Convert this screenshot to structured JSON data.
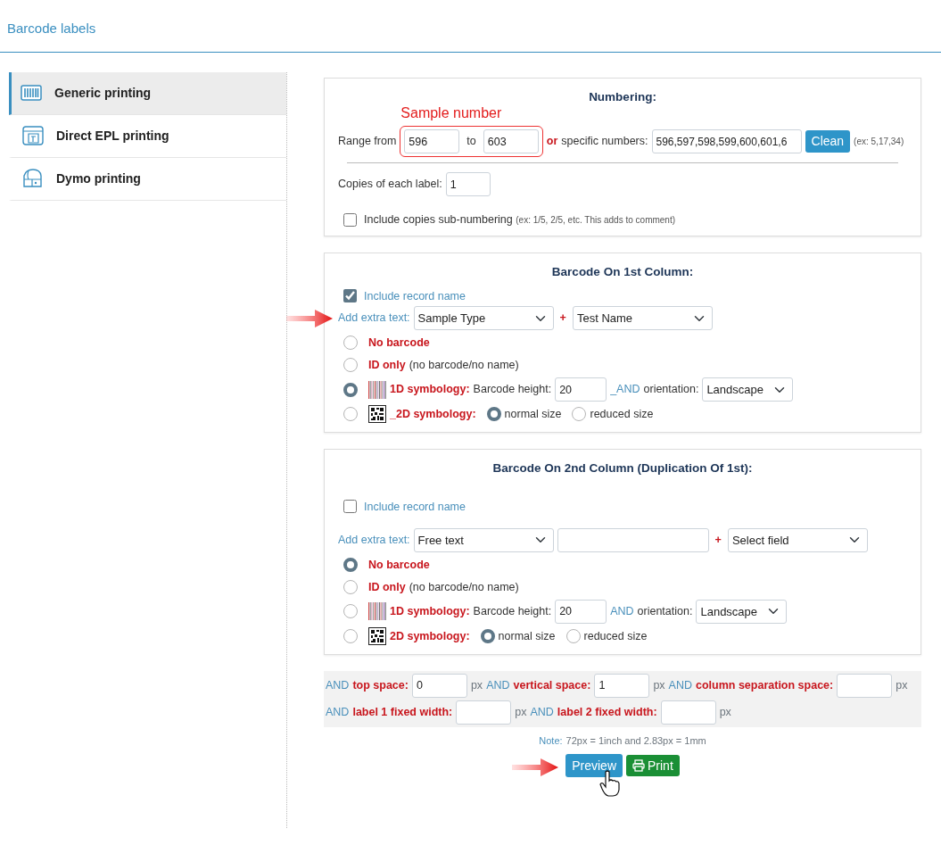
{
  "page_title": "Barcode labels",
  "sidebar": {
    "items": [
      {
        "label": "Generic printing",
        "selected": true,
        "kind": "barcode"
      },
      {
        "label": "Direct EPL printing",
        "selected": false,
        "kind": "epl"
      },
      {
        "label": "Dymo printing",
        "selected": false,
        "kind": "dymo"
      }
    ]
  },
  "numbering": {
    "title": "Numbering:",
    "annotation": "Sample number",
    "range_label": "Range from",
    "range_from": "596",
    "to_label": "to",
    "range_to": "603",
    "or_label": "or",
    "specific_label": "specific numbers:",
    "specific_value": "596,597,598,599,600,601,6",
    "clean_button": "Clean",
    "example": "(ex: 5,17,34)",
    "copies_label": "Copies of each label:",
    "copies_value": "1",
    "subnumbering": {
      "label": "Include copies sub-numbering",
      "hint": "(ex: 1/5, 2/5, etc. This adds to comment)",
      "checked": false
    }
  },
  "columns": [
    {
      "title": "Barcode On 1st Column:",
      "pointer_arrow": true,
      "include_record_name": {
        "label": "Include record name",
        "checked": true
      },
      "extra_text_label": "Add extra text:",
      "extra_fields": [
        {
          "kind": "select",
          "value": "Sample Type"
        },
        {
          "kind": "plus",
          "text": "+"
        },
        {
          "kind": "select",
          "value": "Test Name"
        }
      ],
      "options": [
        {
          "kind": "none",
          "label": "No barcode",
          "selected": false
        },
        {
          "kind": "id",
          "label": "ID only",
          "note": "(no barcode/no name)",
          "selected": false
        },
        {
          "kind": "linear",
          "label": "1D symbology:",
          "height_label": "Barcode height:",
          "height_value": "20",
          "and_label": "_AND",
          "orientation_label": "orientation:",
          "orientation_value": "Landscape",
          "selected": true
        },
        {
          "kind": "matrix",
          "label": "_2D symbology:",
          "selected": false,
          "sizes": [
            {
              "label": "normal size",
              "selected": true
            },
            {
              "label": "reduced size",
              "selected": false
            }
          ]
        }
      ]
    },
    {
      "title": "Barcode On 2nd Column (Duplication Of 1st):",
      "include_record_name": {
        "label": "Include record name",
        "checked": false
      },
      "extra_text_label": "Add extra text:",
      "extra_fields": [
        {
          "kind": "select",
          "value": "Free text"
        },
        {
          "kind": "text"
        },
        {
          "kind": "plus",
          "text": "+"
        },
        {
          "kind": "select",
          "value": "Select field"
        }
      ],
      "options": [
        {
          "kind": "none",
          "label": "No barcode",
          "selected": true
        },
        {
          "kind": "id",
          "label": "ID only",
          "note": "(no barcode/no name)",
          "selected": false
        },
        {
          "kind": "linear",
          "label": "1D symbology:",
          "height_label": "Barcode height:",
          "height_value": "20",
          "and_label": "AND",
          "orientation_label": "orientation:",
          "orientation_value": "Landscape",
          "selected": false
        },
        {
          "kind": "matrix",
          "label": "2D symbology:",
          "selected": false,
          "sizes": [
            {
              "label": "normal size",
              "selected": true
            },
            {
              "label": "reduced size",
              "selected": false
            }
          ]
        }
      ]
    }
  ],
  "spacing": {
    "fields": [
      {
        "and": "AND",
        "label": "top space:",
        "value": "0",
        "unit": "px"
      },
      {
        "and": "AND",
        "label": "vertical space:",
        "value": "1",
        "unit": "px"
      },
      {
        "and": "AND",
        "label": "column separation space:",
        "unit": "px"
      },
      {
        "and": "AND",
        "label": "label 1 fixed width:",
        "unit": "px"
      },
      {
        "and": "AND",
        "label": "label 2 fixed width:",
        "unit": "px"
      }
    ]
  },
  "note": {
    "label": "Note:",
    "text": "72px = 1inch and 2.83px = 1mm"
  },
  "buttons": [
    {
      "kind": "preview",
      "label": "Preview",
      "pointer_arrow": true
    },
    {
      "kind": "print",
      "label": "Print"
    }
  ]
}
